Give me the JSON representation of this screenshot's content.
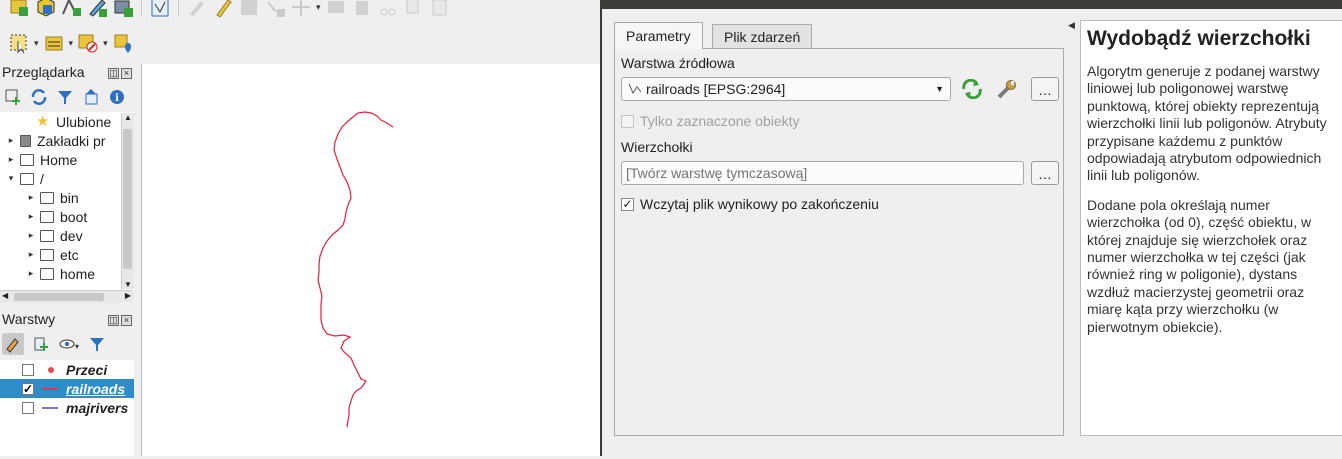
{
  "browser_panel": {
    "title": "Przeglądarka",
    "items": [
      {
        "label": "Ulubione",
        "icon": "star-icon",
        "expander": ""
      },
      {
        "label": "Zakładki pr",
        "icon": "bookmark-icon",
        "expander": "▸"
      },
      {
        "label": "Home",
        "icon": "home-folder-icon",
        "expander": "▸"
      },
      {
        "label": "/",
        "icon": "folder-icon",
        "expander": "▾"
      },
      {
        "label": "bin",
        "icon": "link-folder-icon",
        "expander": "▸"
      },
      {
        "label": "boot",
        "icon": "folder-icon",
        "expander": "▸"
      },
      {
        "label": "dev",
        "icon": "folder-icon",
        "expander": "▸"
      },
      {
        "label": "etc",
        "icon": "folder-icon",
        "expander": "▸"
      },
      {
        "label": "home",
        "icon": "folder-icon",
        "expander": "▸"
      }
    ]
  },
  "layers_panel": {
    "title": "Warstwy",
    "layers": [
      {
        "name": "Przeci",
        "checked": "",
        "symbol": "point",
        "color": "#e05050",
        "selected": false
      },
      {
        "name": "railroads",
        "checked": "✓",
        "symbol": "line",
        "color": "#e0325a",
        "selected": true
      },
      {
        "name": "majrivers",
        "checked": "",
        "symbol": "line",
        "color": "#8b6fd1",
        "selected": false
      }
    ]
  },
  "map": {
    "railroad_color": "#e0203c"
  },
  "dialog": {
    "tabs": [
      {
        "label": "Parametry",
        "active": true
      },
      {
        "label": "Plik zdarzeń",
        "active": false
      }
    ],
    "source_label": "Warstwa źródłowa",
    "source_value": "railroads [EPSG:2964]",
    "selected_only_label": "Tylko zaznaczone obiekty",
    "output_label": "Wierzchołki",
    "output_placeholder": "[Twórz warstwę tymczasową]",
    "load_output_label": "Wczytaj plik wynikowy po zakończeniu",
    "load_output_checked": "✓",
    "browse_label": "…"
  },
  "help": {
    "title": "Wydobądź wierzchołki",
    "paragraphs": [
      "Algorytm generuje z podanej warstwy liniowej lub poligonowej warstwę punktową, której obiekty reprezentują wierzchołki linii lub poligonów. Atrybuty przypisane każdemu z punktów odpowiadają atrybutom odpowiednich linii lub poligonów.",
      "Dodane pola określają numer wierzchołka (od 0), część obiektu, w której znajduje się wierzchołek oraz numer wierzchołka w tej części (jak również ring w poligonie), dystans wzdłuż macierzystej geometrii oraz miarę kąta przy wierzchołku (w pierwotnym obiekcie)."
    ]
  },
  "colors": {
    "selection": "#308cc6",
    "refresh_green": "#3aa03a",
    "icon_blue": "#2f6fc4",
    "icon_yellow": "#e8c53a"
  }
}
